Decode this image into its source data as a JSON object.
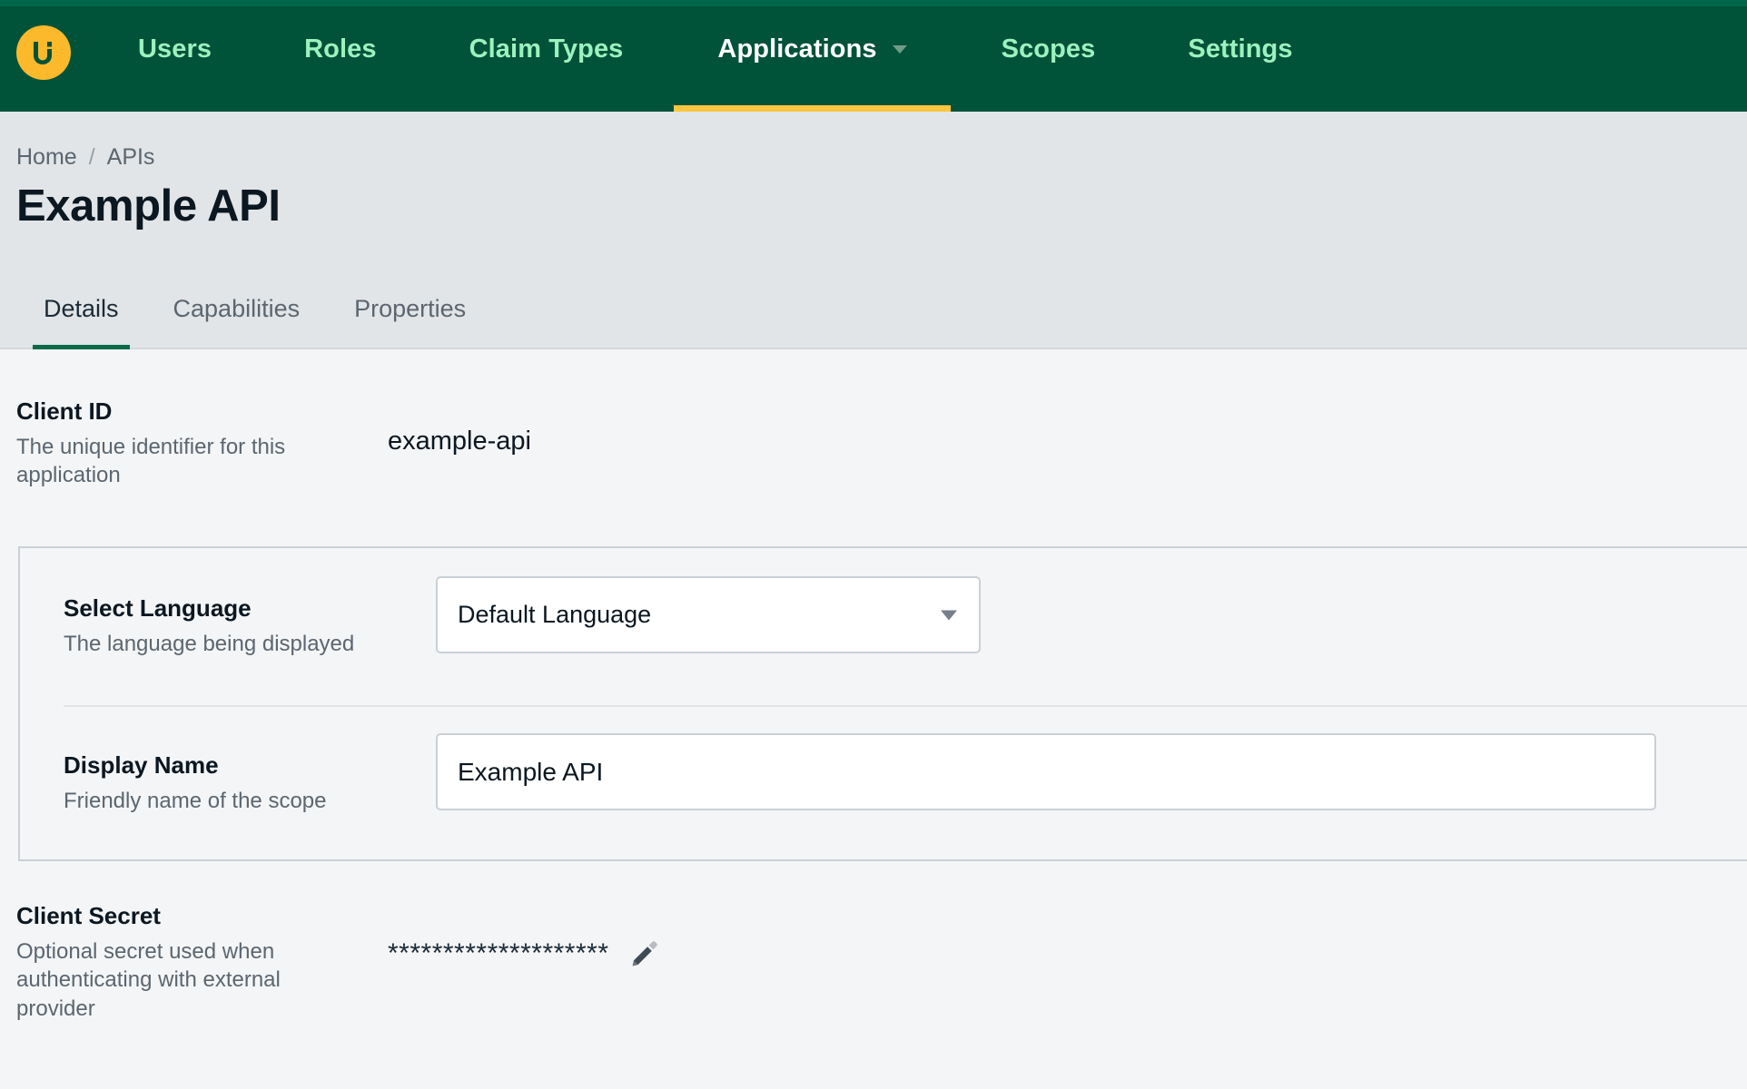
{
  "nav": {
    "logo_icon": "brand-u-logo-icon",
    "items": [
      {
        "label": "Users",
        "active": false,
        "has_caret": false
      },
      {
        "label": "Roles",
        "active": false,
        "has_caret": false
      },
      {
        "label": "Claim Types",
        "active": false,
        "has_caret": false
      },
      {
        "label": "Applications",
        "active": true,
        "has_caret": true
      },
      {
        "label": "Scopes",
        "active": false,
        "has_caret": false
      },
      {
        "label": "Settings",
        "active": false,
        "has_caret": false
      }
    ]
  },
  "header": {
    "breadcrumb": {
      "home": "Home",
      "separator": "/",
      "current": "APIs"
    },
    "title": "Example API",
    "tabs": [
      {
        "label": "Details",
        "active": true
      },
      {
        "label": "Capabilities",
        "active": false
      },
      {
        "label": "Properties",
        "active": false
      }
    ]
  },
  "details": {
    "client_id": {
      "label": "Client ID",
      "description": "The unique identifier for this application",
      "value": "example-api"
    },
    "select_language": {
      "label": "Select Language",
      "description": "The language being displayed",
      "selected": "Default Language",
      "caret_icon": "chevron-down-icon"
    },
    "display_name": {
      "label": "Display Name",
      "description": "Friendly name of the scope",
      "value": "Example API"
    },
    "client_secret": {
      "label": "Client Secret",
      "description": "Optional secret used when authenticating with external provider",
      "masked_value": "********************",
      "edit_icon": "pencil-edit-icon"
    }
  },
  "colors": {
    "nav_background": "#005239",
    "nav_top_line": "#00684a",
    "nav_link": "#9bf2bd",
    "nav_active_text": "#ffffff",
    "nav_active_underline": "#fdc63f",
    "logo_background": "#fcb92c",
    "header_band": "#e1e5e7",
    "content_background": "#f4f5f6",
    "tab_active_underline": "#0a6b48",
    "text_primary": "#0b1721",
    "text_muted": "#5b6670",
    "border": "#c9d0d6"
  }
}
